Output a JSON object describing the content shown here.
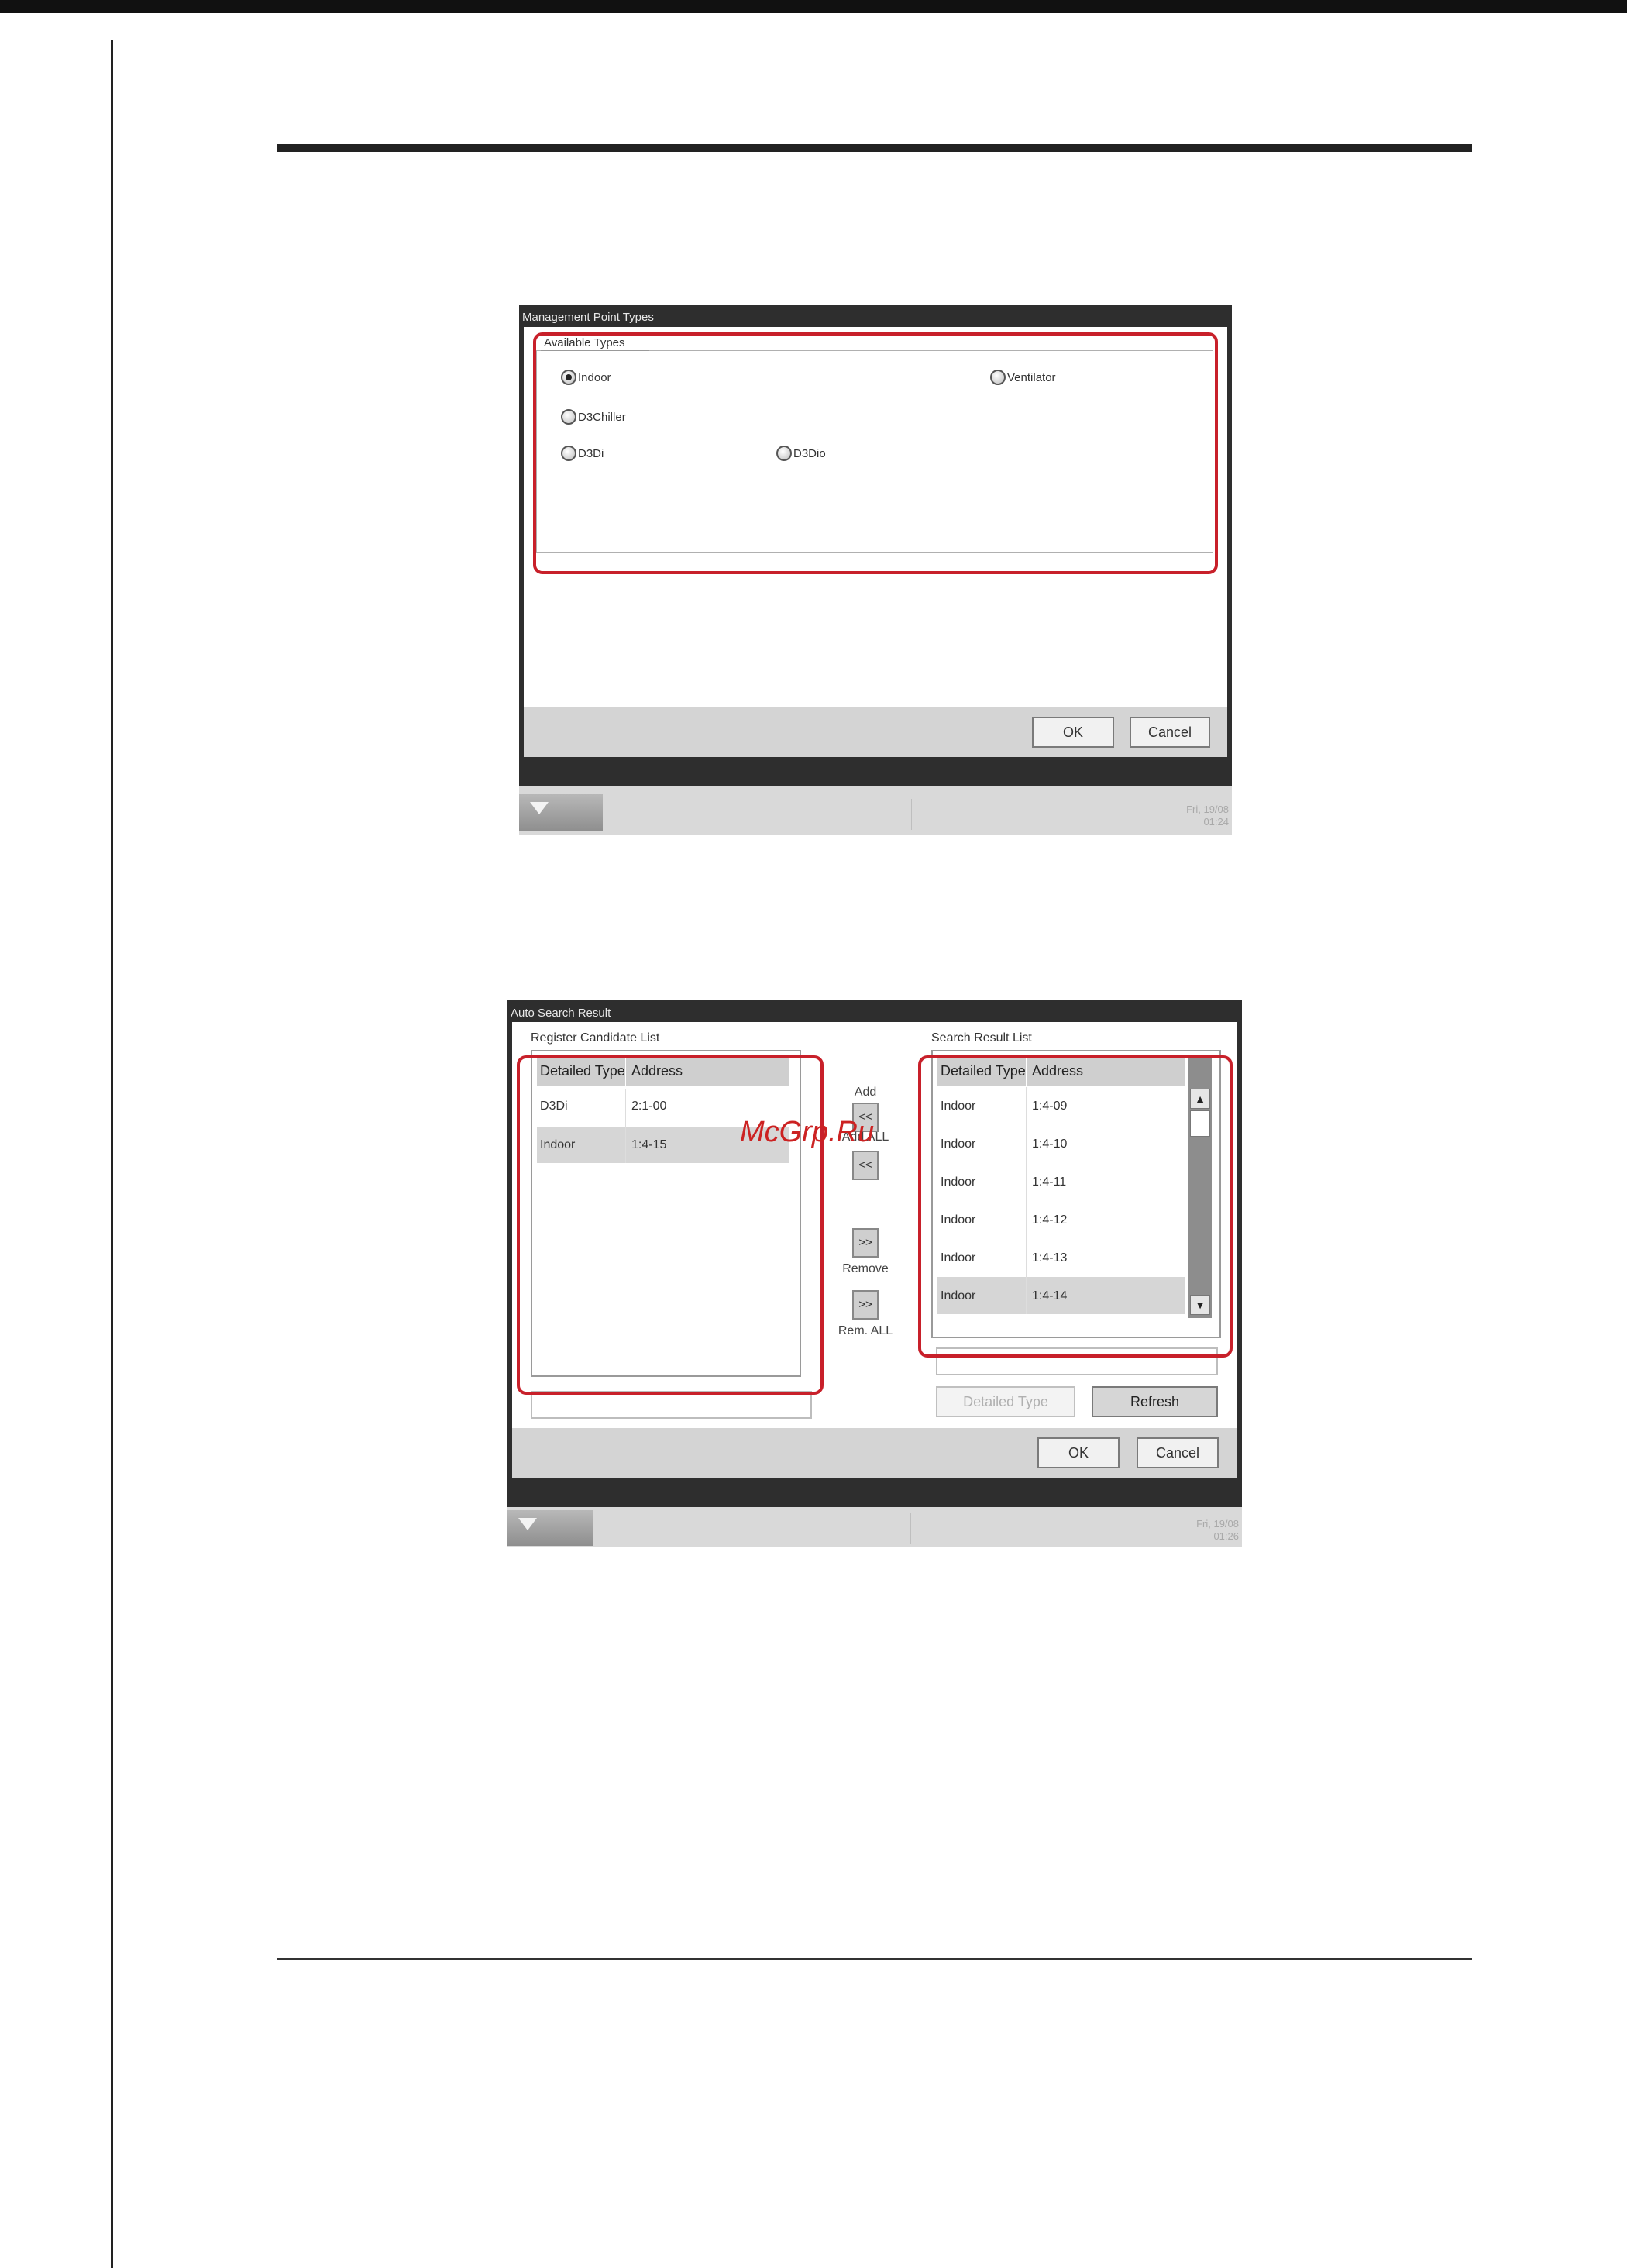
{
  "dialog1": {
    "title": "Management Point Types",
    "group_label": "Available Types",
    "radios": [
      {
        "label": "Indoor",
        "checked": true
      },
      {
        "label": "Ventilator",
        "checked": false
      },
      {
        "label": "D3Chiller",
        "checked": false
      },
      {
        "label": "D3Di",
        "checked": false
      },
      {
        "label": "D3Dio",
        "checked": false
      }
    ],
    "ok_label": "OK",
    "cancel_label": "Cancel",
    "clock": {
      "date": "Fri, 19/08",
      "time": "01:24"
    }
  },
  "dialog2": {
    "title": "Auto Search Result",
    "register_label": "Register Candidate List",
    "search_label": "Search Result List",
    "columns": [
      "Detailed Type",
      "Address"
    ],
    "register_rows": [
      {
        "type": "D3Di",
        "address": "2:1-00",
        "selected": false
      },
      {
        "type": "Indoor",
        "address": "1:4-15",
        "selected": true
      }
    ],
    "search_rows": [
      {
        "type": "Indoor",
        "address": "1:4-09",
        "selected": false
      },
      {
        "type": "Indoor",
        "address": "1:4-10",
        "selected": false
      },
      {
        "type": "Indoor",
        "address": "1:4-11",
        "selected": false
      },
      {
        "type": "Indoor",
        "address": "1:4-12",
        "selected": false
      },
      {
        "type": "Indoor",
        "address": "1:4-13",
        "selected": false
      },
      {
        "type": "Indoor",
        "address": "1:4-14",
        "selected": true
      }
    ],
    "add_label": "Add",
    "add_all_label": "Add ALL",
    "remove_label": "Remove",
    "rem_all_label": "Rem. ALL",
    "add_btn": "<<",
    "add_all_btn": "<<",
    "remove_btn": ">>",
    "rem_all_btn": ">>",
    "detailed_type_btn": "Detailed Type",
    "refresh_btn": "Refresh",
    "ok_label": "OK",
    "cancel_label": "Cancel",
    "clock": {
      "date": "Fri, 19/08",
      "time": "01:26"
    }
  },
  "watermark": "McGrp.Ru",
  "icons": {
    "taskbar_arrow": "down-arrow-icon",
    "scroll_up": "scroll-up-icon",
    "scroll_down": "scroll-down-icon"
  }
}
